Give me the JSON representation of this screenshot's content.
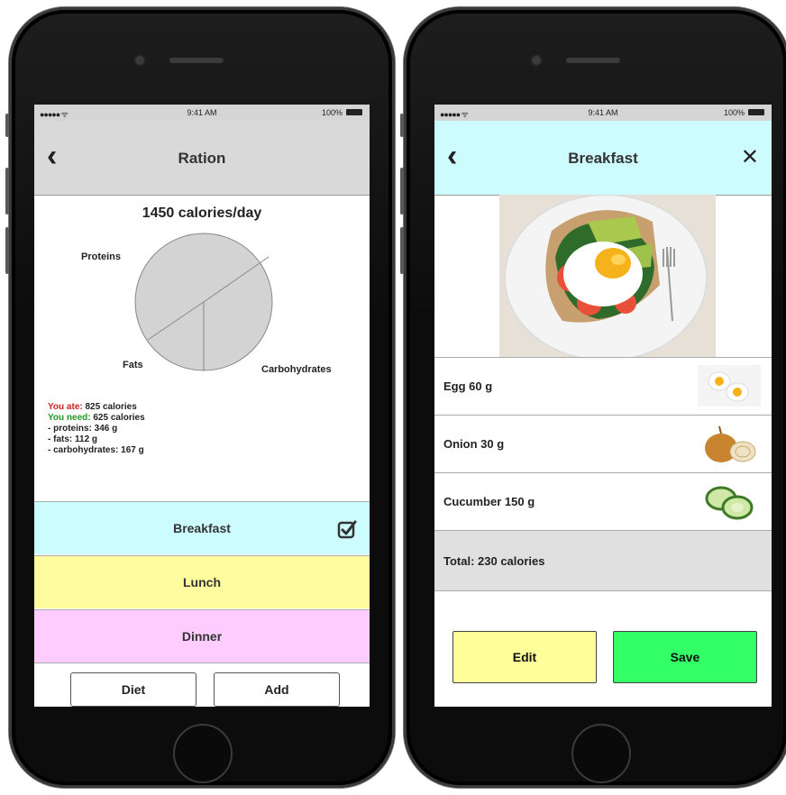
{
  "status_bar": {
    "signal": "●●●●● ᯤ",
    "time": "9:41 AM",
    "battery_left": "100%",
    "battery_right": "100%"
  },
  "ration_screen": {
    "title": "Ration",
    "calories_title": "1450 calories/day",
    "pie_labels": {
      "proteins": "Proteins",
      "fats": "Fats",
      "carbs": "Carbohydrates"
    },
    "stats": {
      "ate_label": "You ate:",
      "ate_value": "825 calories",
      "need_label": "You need:",
      "need_value": "625 calories",
      "proteins": "- proteins: 346 g",
      "fats": "- fats: 112 g",
      "carbs": "- carbohydrates: 167 g"
    },
    "meals": [
      {
        "label": "Breakfast",
        "checked": true,
        "color": "#ccfcfd"
      },
      {
        "label": "Lunch",
        "color": "#fffc9f"
      },
      {
        "label": "Dinner",
        "color": "#ffccff"
      }
    ],
    "buttons": {
      "diet": "Diet",
      "add": "Add"
    }
  },
  "breakfast_screen": {
    "title": "Breakfast",
    "ingredients": [
      {
        "label": "Egg 60 g",
        "icon": "egg-icon"
      },
      {
        "label": "Onion 30 g",
        "icon": "onion-icon"
      },
      {
        "label": "Cucumber 150 g",
        "icon": "cucumber-icon"
      }
    ],
    "total": "Total: 230 calories",
    "buttons": {
      "edit": "Edit",
      "save": "Save"
    }
  },
  "colors": {
    "breakfast": "#ccfcfd",
    "lunch": "#fffc9f",
    "dinner": "#ffccff",
    "edit": "#ffff99",
    "save": "#33ff66",
    "nav_left": "#d9d9d9",
    "nav_right": "#ccfcfd"
  }
}
